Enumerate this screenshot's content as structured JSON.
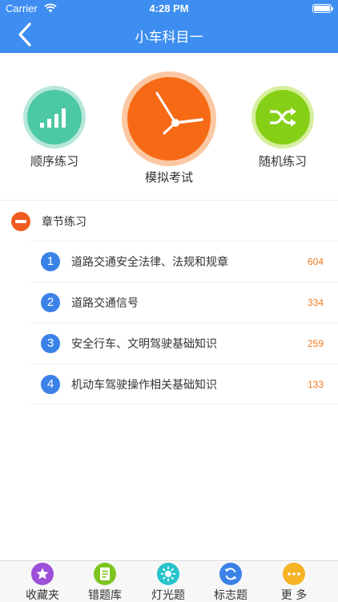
{
  "status_bar": {
    "carrier": "Carrier",
    "time": "4:28 PM"
  },
  "nav": {
    "title": "小车科目一"
  },
  "modes": {
    "sequential": {
      "label": "顺序练习",
      "color": "#4cc8a3"
    },
    "exam": {
      "label": "模拟考试",
      "color": "#f76a15"
    },
    "random": {
      "label": "随机练习",
      "color": "#86cf17"
    }
  },
  "chapters": {
    "title": "章节练习",
    "items": [
      {
        "num": "1",
        "label": "道路交通安全法律、法规和规章",
        "count": "604"
      },
      {
        "num": "2",
        "label": "道路交通信号",
        "count": "334"
      },
      {
        "num": "3",
        "label": "安全行车、文明驾驶基础知识",
        "count": "259"
      },
      {
        "num": "4",
        "label": "机动车驾驶操作相关基础知识",
        "count": "133"
      }
    ]
  },
  "tabs": [
    {
      "label": "收藏夹",
      "icon": "star-icon",
      "color": "#9c4fd8"
    },
    {
      "label": "错题库",
      "icon": "document-icon",
      "color": "#7cc520"
    },
    {
      "label": "灯光题",
      "icon": "sun-icon",
      "color": "#26c3cc"
    },
    {
      "label": "标志题",
      "icon": "refresh-icon",
      "color": "#3b82e8"
    },
    {
      "label": "更 多",
      "icon": "more-icon",
      "color": "#f5b325"
    }
  ]
}
